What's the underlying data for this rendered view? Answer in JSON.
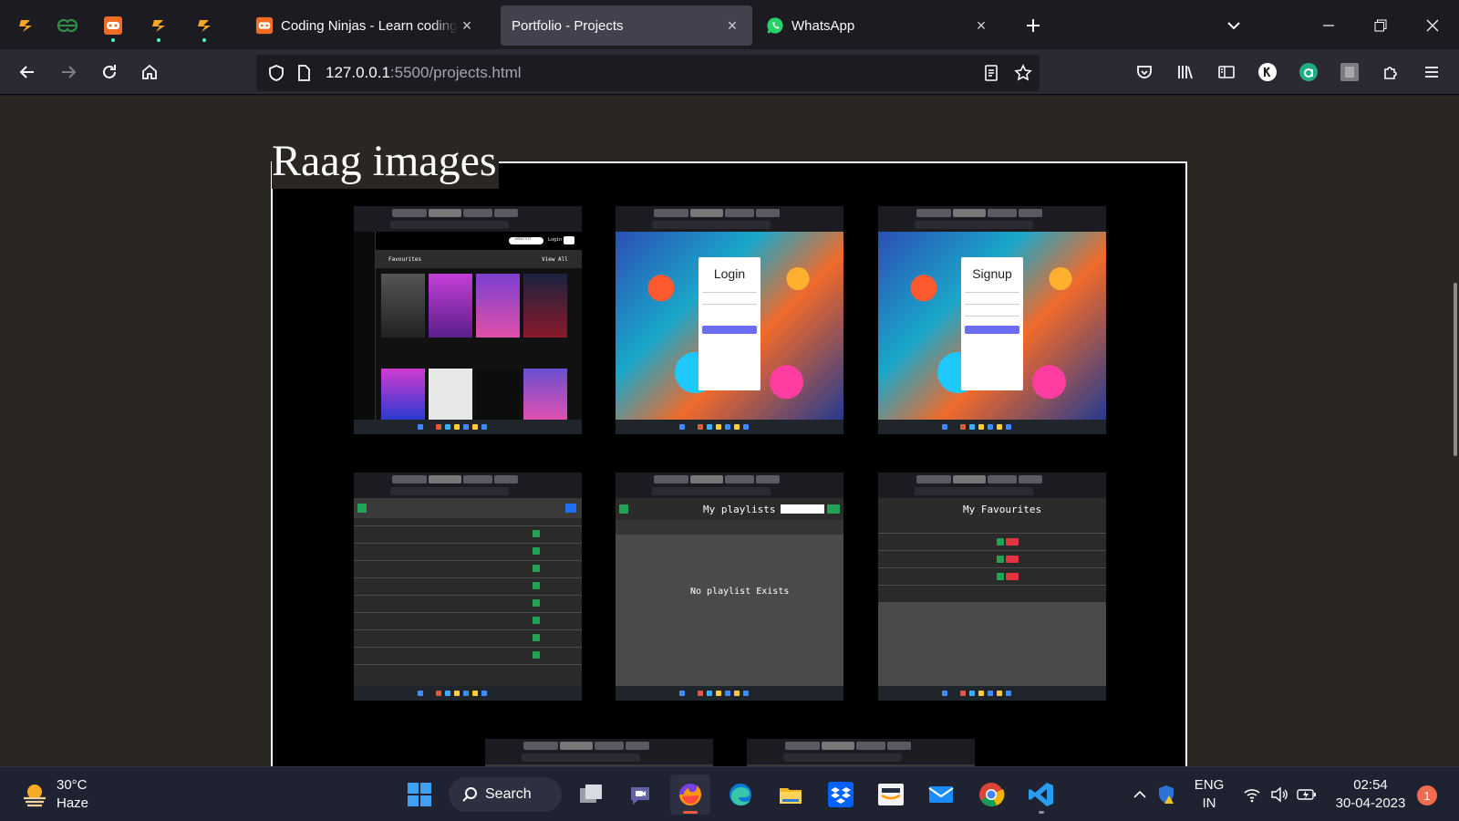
{
  "browser": {
    "pinned_tabs": [
      {
        "name": "pinned-tab-codestudio"
      },
      {
        "name": "pinned-tab-geeksforgeeks"
      },
      {
        "name": "pinned-tab-codingninjas"
      },
      {
        "name": "pinned-tab-codestudio-2"
      },
      {
        "name": "pinned-tab-codestudio-3"
      }
    ],
    "tabs": [
      {
        "title": "Coding Ninjas - Learn coding online",
        "active": false
      },
      {
        "title": "Portfolio - Projects",
        "active": true
      },
      {
        "title": "WhatsApp",
        "active": false
      }
    ],
    "url_host": "127.0.0.1",
    "url_path": ":5500/projects.html"
  },
  "page": {
    "section_title": "Raag images",
    "screenshots": [
      {
        "name": "home-favourites",
        "labels": {
          "heading": "Favourites",
          "view_all": "View All",
          "search": "Search",
          "login": "Login",
          "signup": "Signup"
        }
      },
      {
        "name": "login-page",
        "labels": {
          "heading": "Login"
        }
      },
      {
        "name": "signup-page",
        "labels": {
          "heading": "Signup"
        }
      },
      {
        "name": "songs-list",
        "labels": {
          "heading": ""
        }
      },
      {
        "name": "playlists-page",
        "labels": {
          "heading": "My playlists",
          "empty": "No playlist Exists"
        }
      },
      {
        "name": "favourites-page",
        "labels": {
          "heading": "My Favourites"
        }
      }
    ]
  },
  "os": {
    "weather": {
      "temp": "30°C",
      "condition": "Haze"
    },
    "search_label": "Search",
    "language": {
      "line1": "ENG",
      "line2": "IN"
    },
    "time": "02:54",
    "date": "30-04-2023",
    "notifications": "1"
  },
  "colors": {
    "page_background": "#2a2723",
    "frame_background": "#000000",
    "active_tab": "#42414d",
    "accent_green": "#54ffbd",
    "taskbar": "#1f2230"
  }
}
